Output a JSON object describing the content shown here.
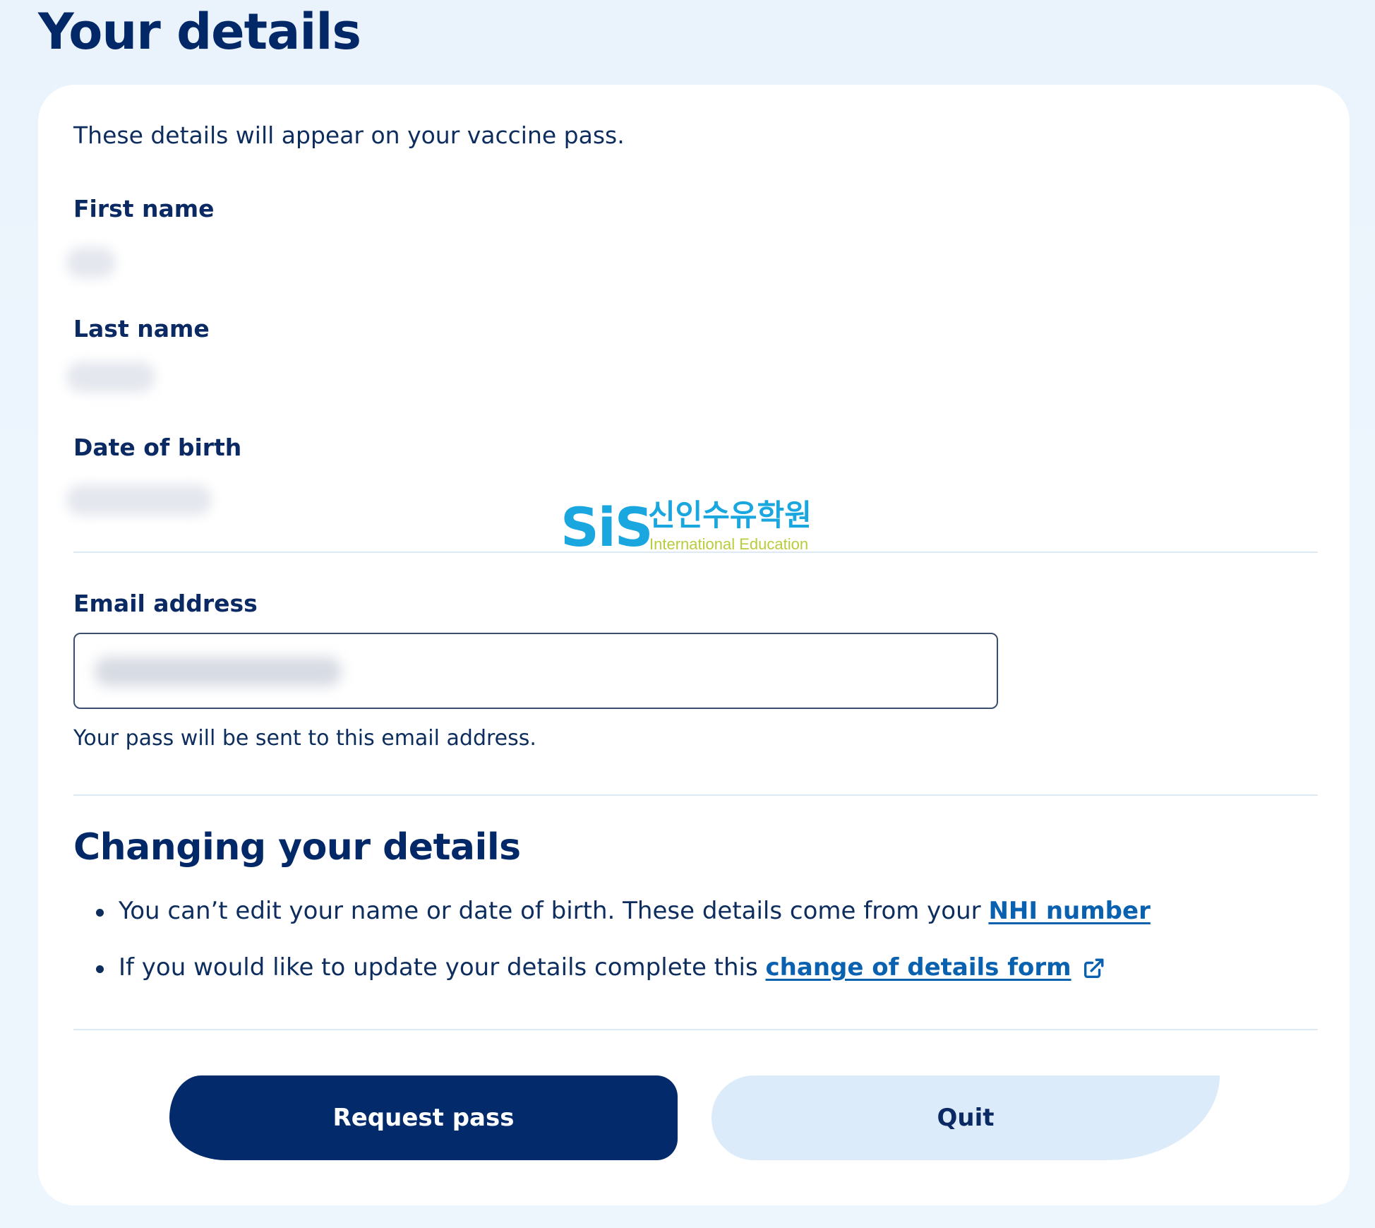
{
  "page": {
    "title": "Your details"
  },
  "card": {
    "intro": "These details will appear on your vaccine pass.",
    "fields": {
      "first_name_label": "First name",
      "last_name_label": "Last name",
      "dob_label": "Date of birth"
    },
    "email": {
      "label": "Email address",
      "helper": "Your pass will be sent to this email address."
    },
    "watermark": {
      "brand": "SiS",
      "korean": "신인수유학원",
      "sub": "International Education"
    },
    "changing": {
      "heading": "Changing your details",
      "bullet1_text": "You can’t edit your name or date of birth. These details come from your ",
      "bullet1_link": "NHI number",
      "bullet2_text": "If you would like to update your details complete this ",
      "bullet2_link": "change of details form",
      "external_icon": "external-link-icon"
    },
    "buttons": {
      "request_pass": "Request pass",
      "quit": "Quit"
    }
  },
  "colors": {
    "primary": "#032a6b",
    "secondary_button": "#dcebfa",
    "link": "#0a61b0",
    "background": "#eaf3fc",
    "logo_blue": "#1aa7df",
    "logo_green": "#b9cc3a"
  }
}
